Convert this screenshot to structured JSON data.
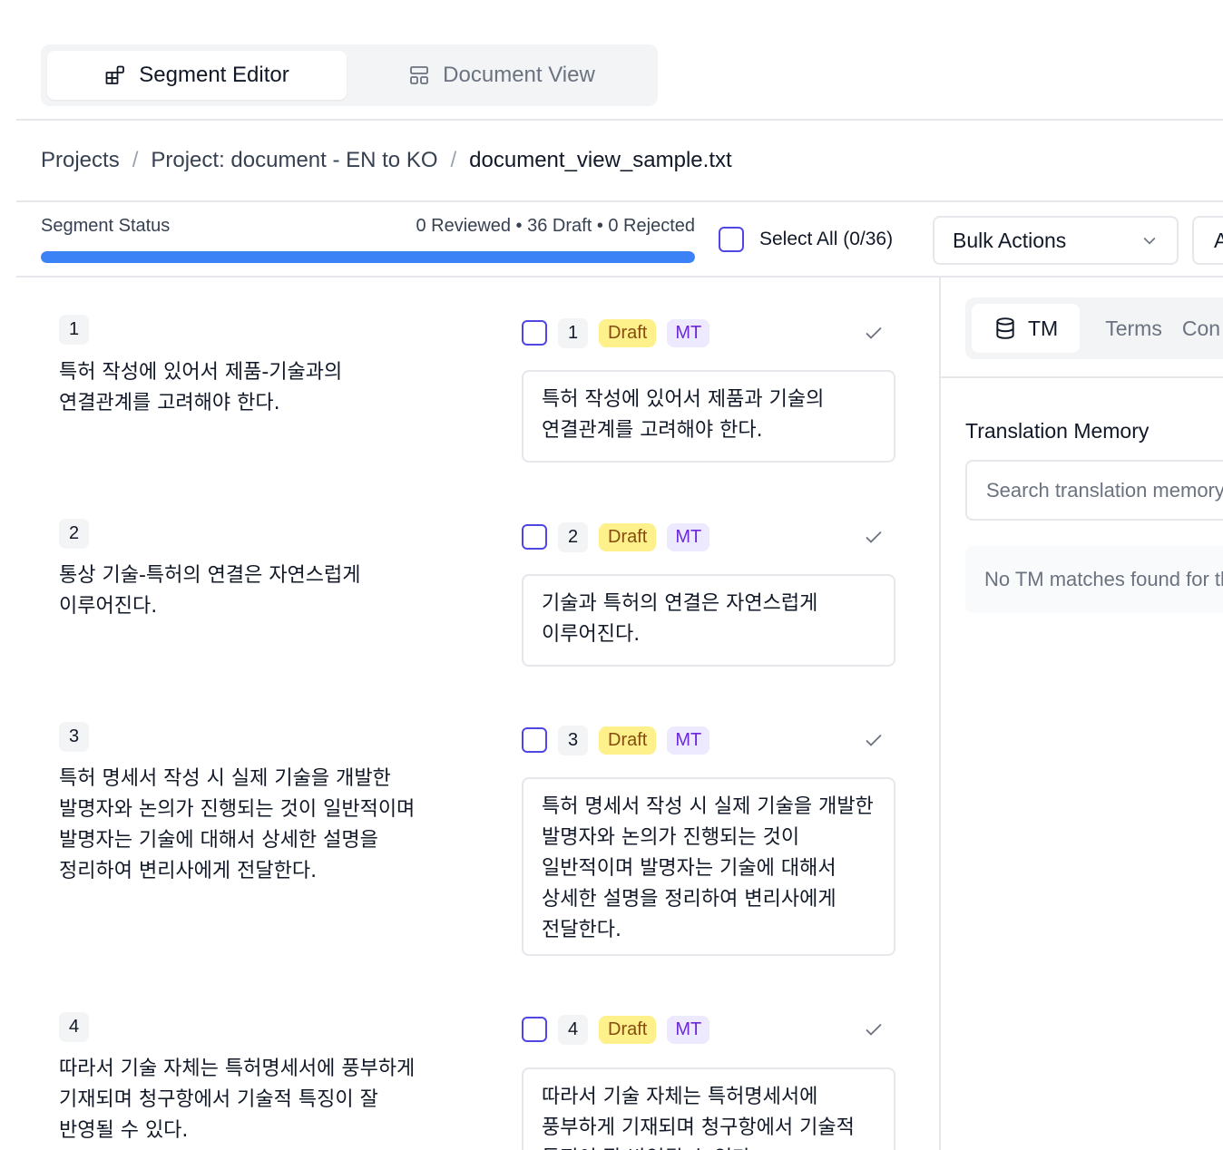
{
  "view_tabs": [
    {
      "label": "Segment Editor",
      "icon": "segments-icon",
      "active": true
    },
    {
      "label": "Document View",
      "icon": "layout-icon",
      "active": false
    }
  ],
  "breadcrumb": {
    "projects": "Projects",
    "project": "Project: document - EN to KO",
    "file": "document_view_sample.txt",
    "separator": "/"
  },
  "status": {
    "label": "Segment Status",
    "counts": "0 Reviewed • 36 Draft • 0 Rejected",
    "progress_fraction": 1.0,
    "progress_color": "#3b82f6"
  },
  "toolbar": {
    "select_all": "Select All (0/36)",
    "bulk_actions": "Bulk Actions",
    "cut_select": "A"
  },
  "segments": [
    {
      "num": "1",
      "source": "특허 작성에 있어서 제품-기술과의 연결관계를 고려해야 한다.",
      "status": "Draft",
      "origin": "MT",
      "target": "특허 작성에 있어서 제품과 기술의 연결관계를 고려해야 한다."
    },
    {
      "num": "2",
      "source": "통상 기술-특허의 연결은 자연스럽게 이루어진다.",
      "status": "Draft",
      "origin": "MT",
      "target": "기술과 특허의 연결은 자연스럽게 이루어진다."
    },
    {
      "num": "3",
      "source": "특허 명세서 작성 시 실제 기술을 개발한 발명자와 논의가 진행되는 것이 일반적이며 발명자는 기술에 대해서 상세한 설명을 정리하여 변리사에게 전달한다.",
      "status": "Draft",
      "origin": "MT",
      "target": "특허 명세서 작성 시 실제 기술을 개발한 발명자와 논의가 진행되는 것이 일반적이며 발명자는 기술에 대해서 상세한 설명을 정리하여 변리사에게 전달한다."
    },
    {
      "num": "4",
      "source": "따라서 기술 자체는 특허명세서에 풍부하게 기재되며 청구항에서 기술적 특징이 잘 반영될 수 있다.",
      "status": "Draft",
      "origin": "MT",
      "target": "따라서 기술 자체는 특허명세서에 풍부하게 기재되며 청구항에서 기술적 특징이 잘 반영될 수 있다."
    }
  ],
  "panel": {
    "tabs": [
      {
        "label": "TM",
        "icon": "database-icon",
        "active": true
      },
      {
        "label": "Terms",
        "active": false
      },
      {
        "label": "Con",
        "active": false
      }
    ],
    "tm_title": "Translation Memory",
    "tm_search_placeholder": "Search translation memory...",
    "tm_empty": "No TM matches found for this segment"
  },
  "colors": {
    "accent": "#4f46e5",
    "draft_badge": "#fef08a",
    "mt_badge": "#ede9fe"
  }
}
